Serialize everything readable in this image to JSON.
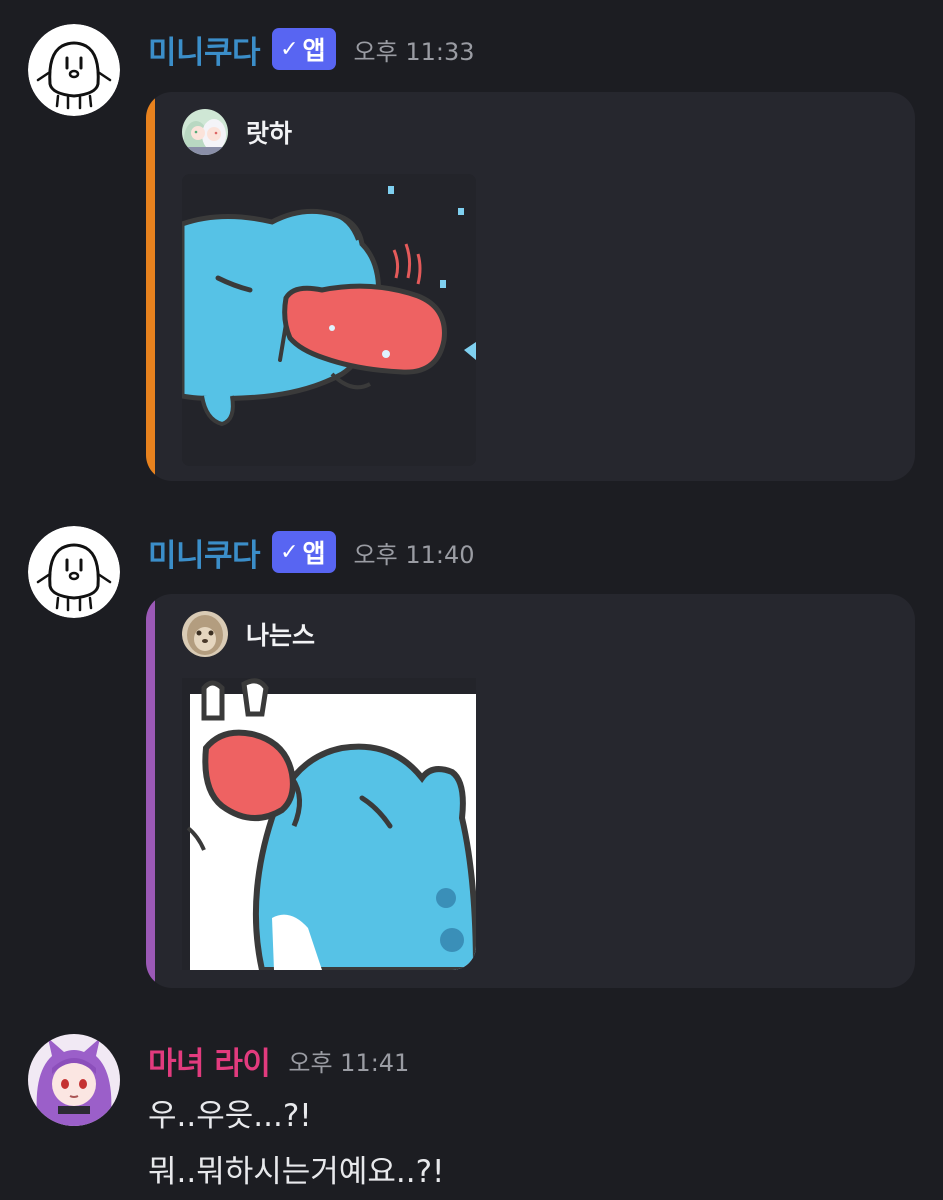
{
  "messages": [
    {
      "username": "미니쿠다",
      "username_color": "#3b8ec9",
      "badge_check": "✓",
      "badge_label": "앱",
      "timestamp": "오후 11:33",
      "avatar_icon": "smiley-face-avatar",
      "embed": {
        "accent_color": "#e8821e",
        "author_name": "랏하",
        "author_avatar_icon": "anime-character-avatar",
        "sticker": "blue-creature-tongue-out-sticker"
      }
    },
    {
      "username": "미니쿠다",
      "username_color": "#3b8ec9",
      "badge_check": "✓",
      "badge_label": "앱",
      "timestamp": "오후 11:40",
      "avatar_icon": "smiley-face-avatar",
      "embed": {
        "accent_color": "#9b59b6",
        "author_name": "나는스",
        "author_avatar_icon": "furry-animal-avatar",
        "sticker": "blue-creature-licking-sticker"
      }
    },
    {
      "username": "마녀 라이",
      "username_color": "#e23b7e",
      "timestamp": "오후 11:41",
      "avatar_icon": "purple-hair-girl-avatar",
      "lines": [
        "우..우읏...?!",
        "뭐..뭐하시는거예요..?!"
      ]
    }
  ],
  "colors": {
    "background": "#1c1d22",
    "embed_background": "#26272e",
    "badge": "#5865f2",
    "timestamp": "#9a9ca3",
    "text": "#e8e9ec"
  }
}
